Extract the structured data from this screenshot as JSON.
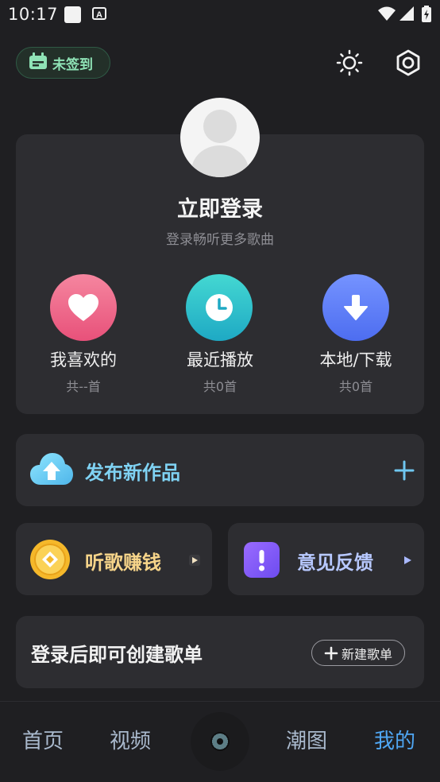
{
  "status_bar": {
    "time": "10:17"
  },
  "header": {
    "checkin_label": "未签到"
  },
  "login": {
    "title": "立即登录",
    "subtitle": "登录畅听更多歌曲"
  },
  "quick_actions": [
    {
      "label": "我喜欢的",
      "count": "共--首",
      "color_from": "#f07aa0",
      "color_to": "#e84d70"
    },
    {
      "label": "最近播放",
      "count": "共0首",
      "color_from": "#3ed7cf",
      "color_to": "#1eaec9"
    },
    {
      "label": "本地/下载",
      "count": "共0首",
      "color_from": "#6f8cff",
      "color_to": "#4a6cf0"
    }
  ],
  "publish": {
    "label": "发布新作品"
  },
  "earn": {
    "label": "听歌赚钱"
  },
  "feedback": {
    "label": "意见反馈"
  },
  "playlist": {
    "title": "登录后即可创建歌单",
    "new_button": "新建歌单"
  },
  "bottom_nav": [
    "首页",
    "视频",
    "潮图",
    "我的"
  ],
  "colors": {
    "background": "#1f1f22",
    "card": "#2d2d31",
    "active_tab": "#4fa6f3"
  }
}
